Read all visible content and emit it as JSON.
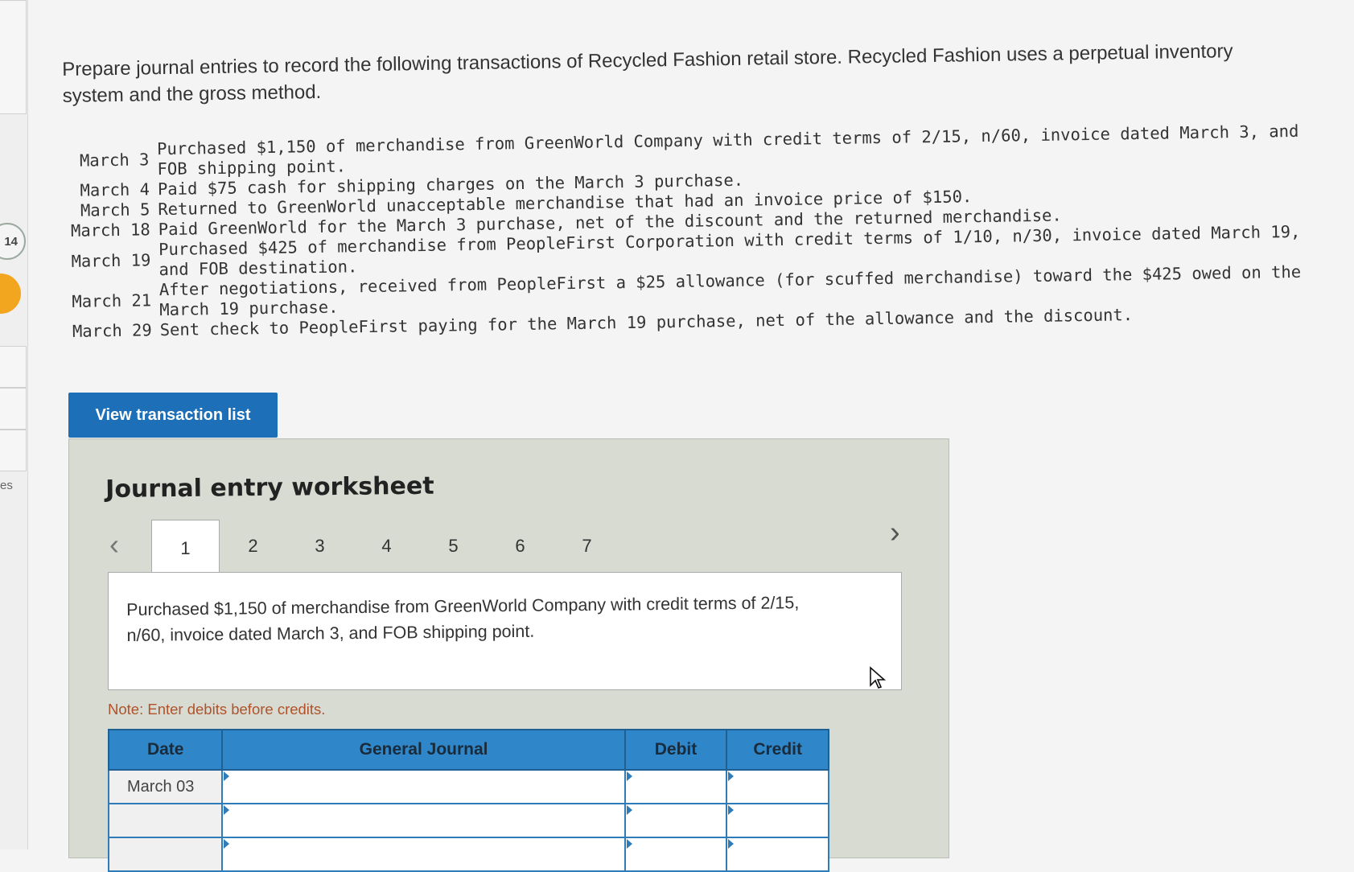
{
  "rail": {
    "badge": "14",
    "label": "es"
  },
  "instructions": "Prepare journal entries to record the following transactions of Recycled Fashion retail store. Recycled Fashion uses a perpetual inventory system and the gross method.",
  "transactions": [
    {
      "date": "March 3",
      "desc": "Purchased $1,150 of merchandise from GreenWorld Company with credit terms of 2/15, n/60, invoice dated March 3, and FOB shipping point."
    },
    {
      "date": "March 4",
      "desc": "Paid $75 cash for shipping charges on the March 3 purchase."
    },
    {
      "date": "March 5",
      "desc": "Returned to GreenWorld unacceptable merchandise that had an invoice price of $150."
    },
    {
      "date": "March 18",
      "desc": "Paid GreenWorld for the March 3 purchase, net of the discount and the returned merchandise."
    },
    {
      "date": "March 19",
      "desc": "Purchased $425 of merchandise from PeopleFirst Corporation with credit terms of 1/10, n/30, invoice dated March 19, and FOB destination."
    },
    {
      "date": "March 21",
      "desc": "After negotiations, received from PeopleFirst a $25 allowance (for scuffed merchandise) toward the $425 owed on the March 19 purchase."
    },
    {
      "date": "March 29",
      "desc": "Sent check to PeopleFirst paying for the March 19 purchase, net of the allowance and the discount."
    }
  ],
  "view_button": "View transaction list",
  "worksheet": {
    "title": "Journal entry worksheet",
    "tabs": [
      "1",
      "2",
      "3",
      "4",
      "5",
      "6",
      "7"
    ],
    "active_tab": "1",
    "description": "Purchased $1,150 of merchandise from GreenWorld Company with credit terms of 2/15, n/60, invoice dated March 3, and FOB shipping point.",
    "note": "Note: Enter debits before credits.",
    "table": {
      "headers": {
        "date": "Date",
        "journal": "General Journal",
        "debit": "Debit",
        "credit": "Credit"
      },
      "rows": [
        {
          "date": "March 03",
          "journal": "",
          "debit": "",
          "credit": ""
        },
        {
          "date": "",
          "journal": "",
          "debit": "",
          "credit": ""
        },
        {
          "date": "",
          "journal": "",
          "debit": "",
          "credit": ""
        }
      ]
    }
  },
  "colors": {
    "accent": "#1d6fb8",
    "table_header": "#2f86c8",
    "note": "#b0522a",
    "worksheet_bg": "#d7dbd2"
  }
}
